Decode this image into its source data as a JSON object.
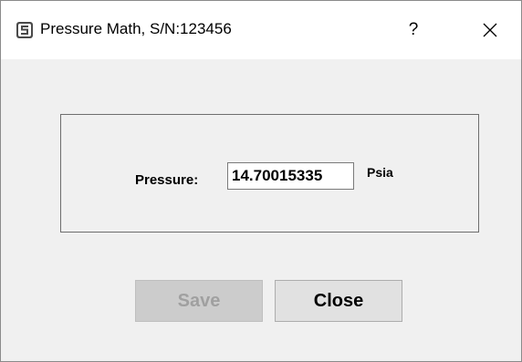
{
  "window": {
    "title": "Pressure Math, S/N:123456",
    "help_label": "?",
    "app_icon": "app-logo-icon",
    "close_icon": "close-icon"
  },
  "form": {
    "pressure_label": "Pressure:",
    "pressure_value": "14.70015335",
    "unit_label": "Psia"
  },
  "buttons": {
    "save_label": "Save",
    "save_enabled": false,
    "close_label": "Close",
    "close_enabled": true
  }
}
